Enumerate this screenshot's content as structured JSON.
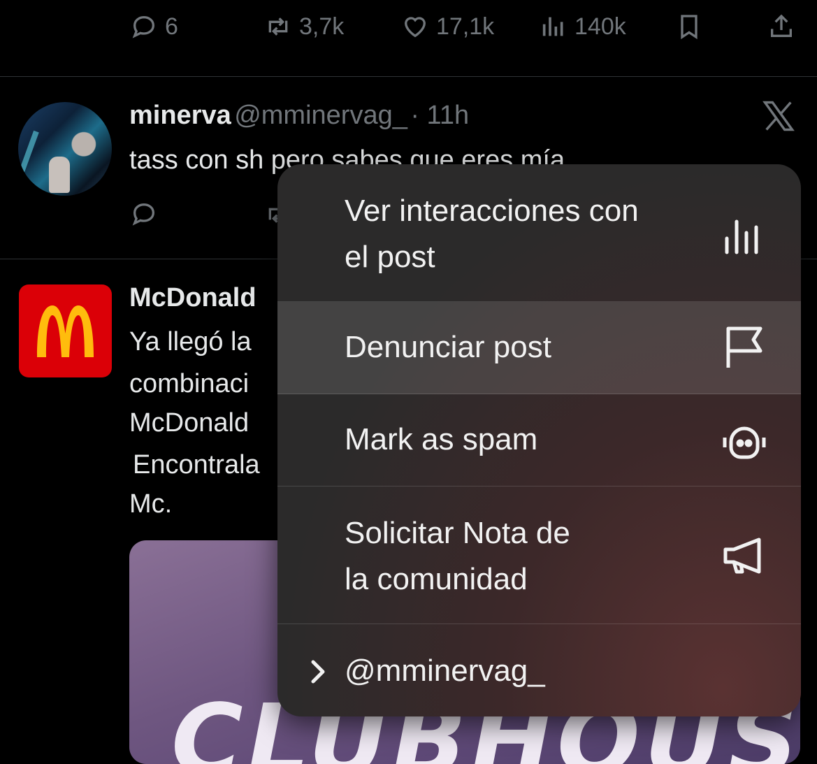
{
  "top_actions": {
    "replies": "6",
    "reposts": "3,7k",
    "likes": "17,1k",
    "views": "140k"
  },
  "tweet1": {
    "name": "minerva",
    "handle": "@mminervag_",
    "time": "· 11h",
    "text": "tass con sh pero sabes que eres mía"
  },
  "tweet2": {
    "name": "McDonald",
    "lines": [
      "Ya llegó la",
      "combinaci",
      "McDonald",
      "Encontrala",
      "Mc."
    ],
    "media_text": "CLUBHOUSE"
  },
  "menu": {
    "items": [
      {
        "line1": "Ver interacciones con",
        "line2": "el post",
        "icon": "bar-chart-icon"
      },
      {
        "line1": "Denunciar post",
        "icon": "flag-icon"
      },
      {
        "line1": "Mark as spam",
        "icon": "robot-icon"
      },
      {
        "line1": "Solicitar Nota de",
        "line2": "la comunidad",
        "icon": "megaphone-icon"
      },
      {
        "line1": "@mminervag_",
        "icon": "chevron-right-icon"
      }
    ]
  },
  "colors": {
    "background": "#000000",
    "muted": "#71767b",
    "mcdonalds_red": "#db0007",
    "mcdonalds_yellow": "#ffbc0d"
  }
}
